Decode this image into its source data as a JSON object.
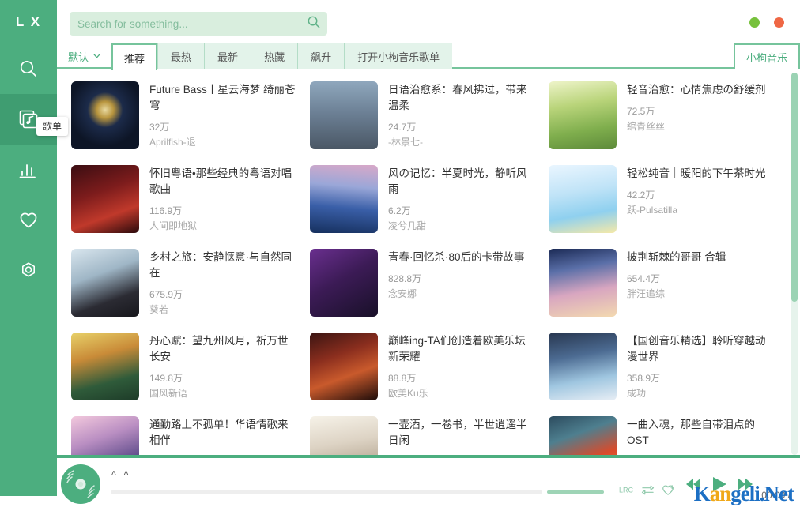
{
  "app": {
    "logo": "L X",
    "tooltip": "歌单"
  },
  "search": {
    "placeholder": "Search for something...",
    "value": ""
  },
  "window_controls": {
    "minimize_label": "",
    "close_label": "",
    "minimize_color": "#77c13c",
    "close_color": "#ef6744"
  },
  "sidebar": {
    "items": [
      {
        "name": "search",
        "icon": "search-icon",
        "active": false
      },
      {
        "name": "songlist",
        "icon": "music-list-icon",
        "active": true
      },
      {
        "name": "ranking",
        "icon": "bar-chart-icon",
        "active": false
      },
      {
        "name": "favorites",
        "icon": "heart-icon",
        "active": false
      },
      {
        "name": "settings",
        "icon": "gear-icon",
        "active": false
      }
    ]
  },
  "tabs": {
    "sort_label": "默认",
    "items": [
      {
        "label": "推荐",
        "active": true
      },
      {
        "label": "最热",
        "active": false
      },
      {
        "label": "最新",
        "active": false
      },
      {
        "label": "热藏",
        "active": false
      },
      {
        "label": "飙升",
        "active": false
      },
      {
        "label": "打开小枸音乐歌单",
        "active": false
      }
    ],
    "source_tab": "小枸音乐"
  },
  "playlists": [
    {
      "title": "Future Bass丨星云海梦 绮丽苍穹",
      "plays": "32万",
      "author": "Aprilfish-退"
    },
    {
      "title": "日语治愈系：春风拂过，带来温柔",
      "plays": "24.7万",
      "author": "-林景七-"
    },
    {
      "title": "轻音治愈：心情焦虑の舒缓剂",
      "plays": "72.5万",
      "author": "綰青丝丝"
    },
    {
      "title": "怀旧粤语•那些经典的粤语对唱歌曲",
      "plays": "116.9万",
      "author": "人间即地狱"
    },
    {
      "title": "风の记忆：半夏时光，静听风雨",
      "plays": "6.2万",
      "author": "凌兮几甜"
    },
    {
      "title": "轻松纯音｜暖阳的下午茶时光",
      "plays": "42.2万",
      "author": "跃-Pulsatilla"
    },
    {
      "title": "乡村之旅：安静惬意·与自然同在",
      "plays": "675.9万",
      "author": "葵若"
    },
    {
      "title": "青春·回忆杀·80后的卡带故事",
      "plays": "828.8万",
      "author": "念安娜"
    },
    {
      "title": "披荆斩棘的哥哥 合辑",
      "plays": "654.4万",
      "author": "胖汪追综"
    },
    {
      "title": "丹心赋：望九州风月，祈万世长安",
      "plays": "149.8万",
      "author": "国风新语"
    },
    {
      "title": "巅峰ing-TA们创造着欧美乐坛新荣耀",
      "plays": "88.8万",
      "author": "欧美Ku乐"
    },
    {
      "title": "【国创音乐精选】聆听穿越动漫世界",
      "plays": "358.9万",
      "author": "成功"
    },
    {
      "title": "通勤路上不孤单！华语情歌来相伴",
      "plays": "",
      "author": ""
    },
    {
      "title": "一壶酒，一卷书，半世逍遥半日闲",
      "plays": "",
      "author": ""
    },
    {
      "title": "一曲入魂，那些自带泪点的OST",
      "plays": "",
      "author": ""
    }
  ],
  "player": {
    "track_name": "^_^",
    "current_time": "00:00",
    "time_separator": "/",
    "total_time": "",
    "progress_percent": 0,
    "volume_percent": 100,
    "icons": {
      "lrc": "lrc-icon",
      "loop": "repeat-icon",
      "like": "heart-plus-icon",
      "prev": "previous-track-icon",
      "play": "play-icon",
      "next": "next-track-icon"
    }
  },
  "watermark": {
    "part1": "K",
    "part2": "an",
    "part3": "g",
    "part4": "eli.Net"
  },
  "colors": {
    "brand_green": "#4cae7f",
    "sidebar_active": "#3f9d71",
    "tab_border": "#76c49c",
    "search_bg": "#d9eede",
    "tab_inactive_bg": "#e3f3ea"
  }
}
